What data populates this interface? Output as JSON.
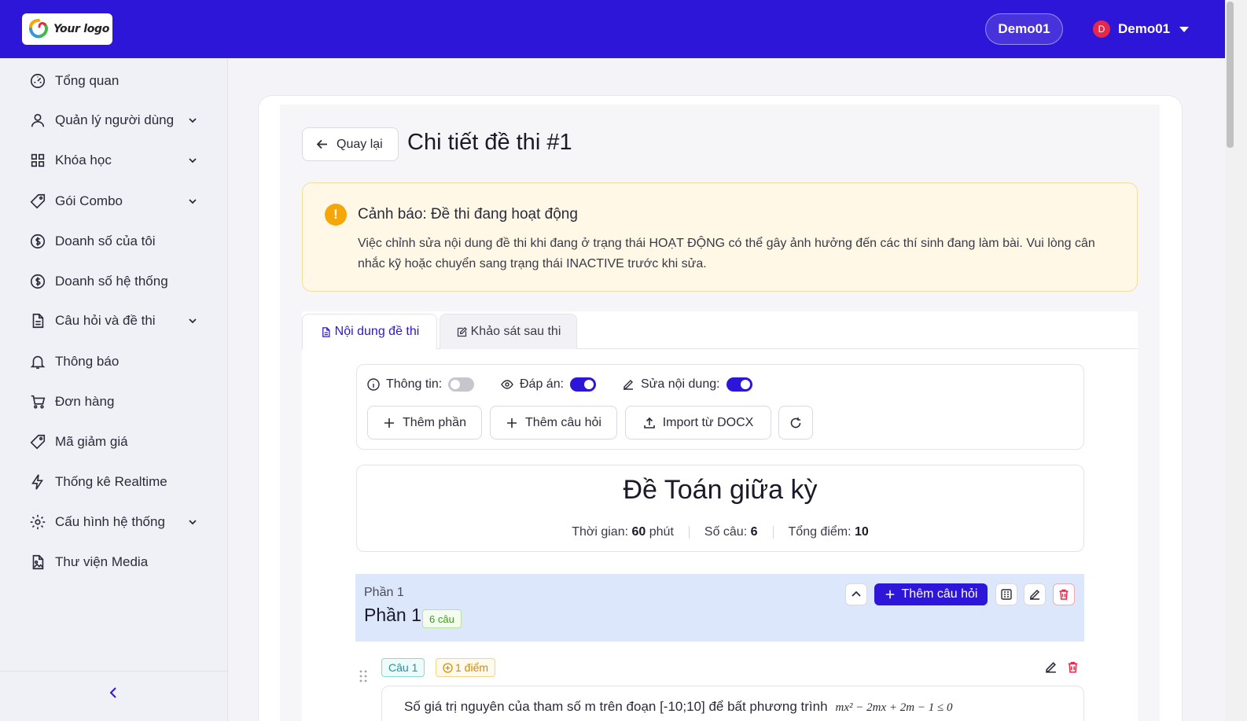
{
  "header": {
    "logo_text": "Your logo",
    "workspace_pill": "Demo01",
    "user_initial": "D",
    "user_name": "Demo01"
  },
  "sidebar": {
    "items": [
      {
        "label": "Tổng quan",
        "icon": "dashboard-icon",
        "expandable": false
      },
      {
        "label": "Quản lý người dùng",
        "icon": "user-icon",
        "expandable": true
      },
      {
        "label": "Khóa học",
        "icon": "grid-icon",
        "expandable": true
      },
      {
        "label": "Gói Combo",
        "icon": "tag-icon",
        "expandable": true
      },
      {
        "label": "Doanh số của tôi",
        "icon": "dollar-circle-icon",
        "expandable": false
      },
      {
        "label": "Doanh số hệ thống",
        "icon": "dollar-circle-icon",
        "expandable": false
      },
      {
        "label": "Câu hỏi và đề thi",
        "icon": "file-text-icon",
        "expandable": true
      },
      {
        "label": "Thông báo",
        "icon": "bell-icon",
        "expandable": false
      },
      {
        "label": "Đơn hàng",
        "icon": "cart-icon",
        "expandable": false
      },
      {
        "label": "Mã giảm giá",
        "icon": "tag-icon",
        "expandable": false
      },
      {
        "label": "Thống kê Realtime",
        "icon": "bolt-icon",
        "expandable": false
      },
      {
        "label": "Cấu hình hệ thống",
        "icon": "gear-icon",
        "expandable": true
      },
      {
        "label": "Thư viện Media",
        "icon": "file-image-icon",
        "expandable": false
      }
    ]
  },
  "page": {
    "back_label": "Quay lại",
    "title": "Chi tiết đề thi #1"
  },
  "alert": {
    "icon": "!",
    "title": "Cảnh báo: Đề thi đang hoạt động",
    "body": "Việc chỉnh sửa nội dung đề thi khi đang ở trạng thái HOẠT ĐỘNG có thể gây ảnh hưởng đến các thí sinh đang làm bài. Vui lòng cân nhắc kỹ hoặc chuyển sang trạng thái INACTIVE trước khi sửa."
  },
  "tabs": [
    {
      "label": "Nội dung đề thi",
      "active": true
    },
    {
      "label": "Khảo sát sau thi",
      "active": false
    }
  ],
  "toolbar": {
    "toggles": [
      {
        "label": "Thông tin:",
        "on": false
      },
      {
        "label": "Đáp án:",
        "on": true
      },
      {
        "label": "Sửa nội dung:",
        "on": true
      }
    ],
    "buttons": {
      "add_section": "Thêm phần",
      "add_question": "Thêm câu hỏi",
      "import_docx": "Import từ DOCX"
    }
  },
  "exam": {
    "title": "Đề Toán giữa kỳ",
    "duration_label": "Thời gian:",
    "duration_value": "60",
    "duration_unit": "phút",
    "count_label": "Số câu:",
    "count_value": "6",
    "total_label": "Tổng điểm:",
    "total_value": "10"
  },
  "section": {
    "subtitle": "Phần 1",
    "title": "Phần 1",
    "badge": "6 câu",
    "add_question": "Thêm câu hỏi"
  },
  "question": {
    "number": "Câu 1",
    "points": "1 điểm",
    "text": "Số giá trị nguyên của tham số m trên đoạn [-10;10] để bất phương trình",
    "math": "mx² − 2mx + 2m − 1 ≤ 0"
  },
  "colors": {
    "primary": "#2e16d8",
    "alert_bg": "#fff8e6",
    "warning": "#f5a70a",
    "section_bg": "#dde7fb",
    "danger": "#e6284b"
  }
}
